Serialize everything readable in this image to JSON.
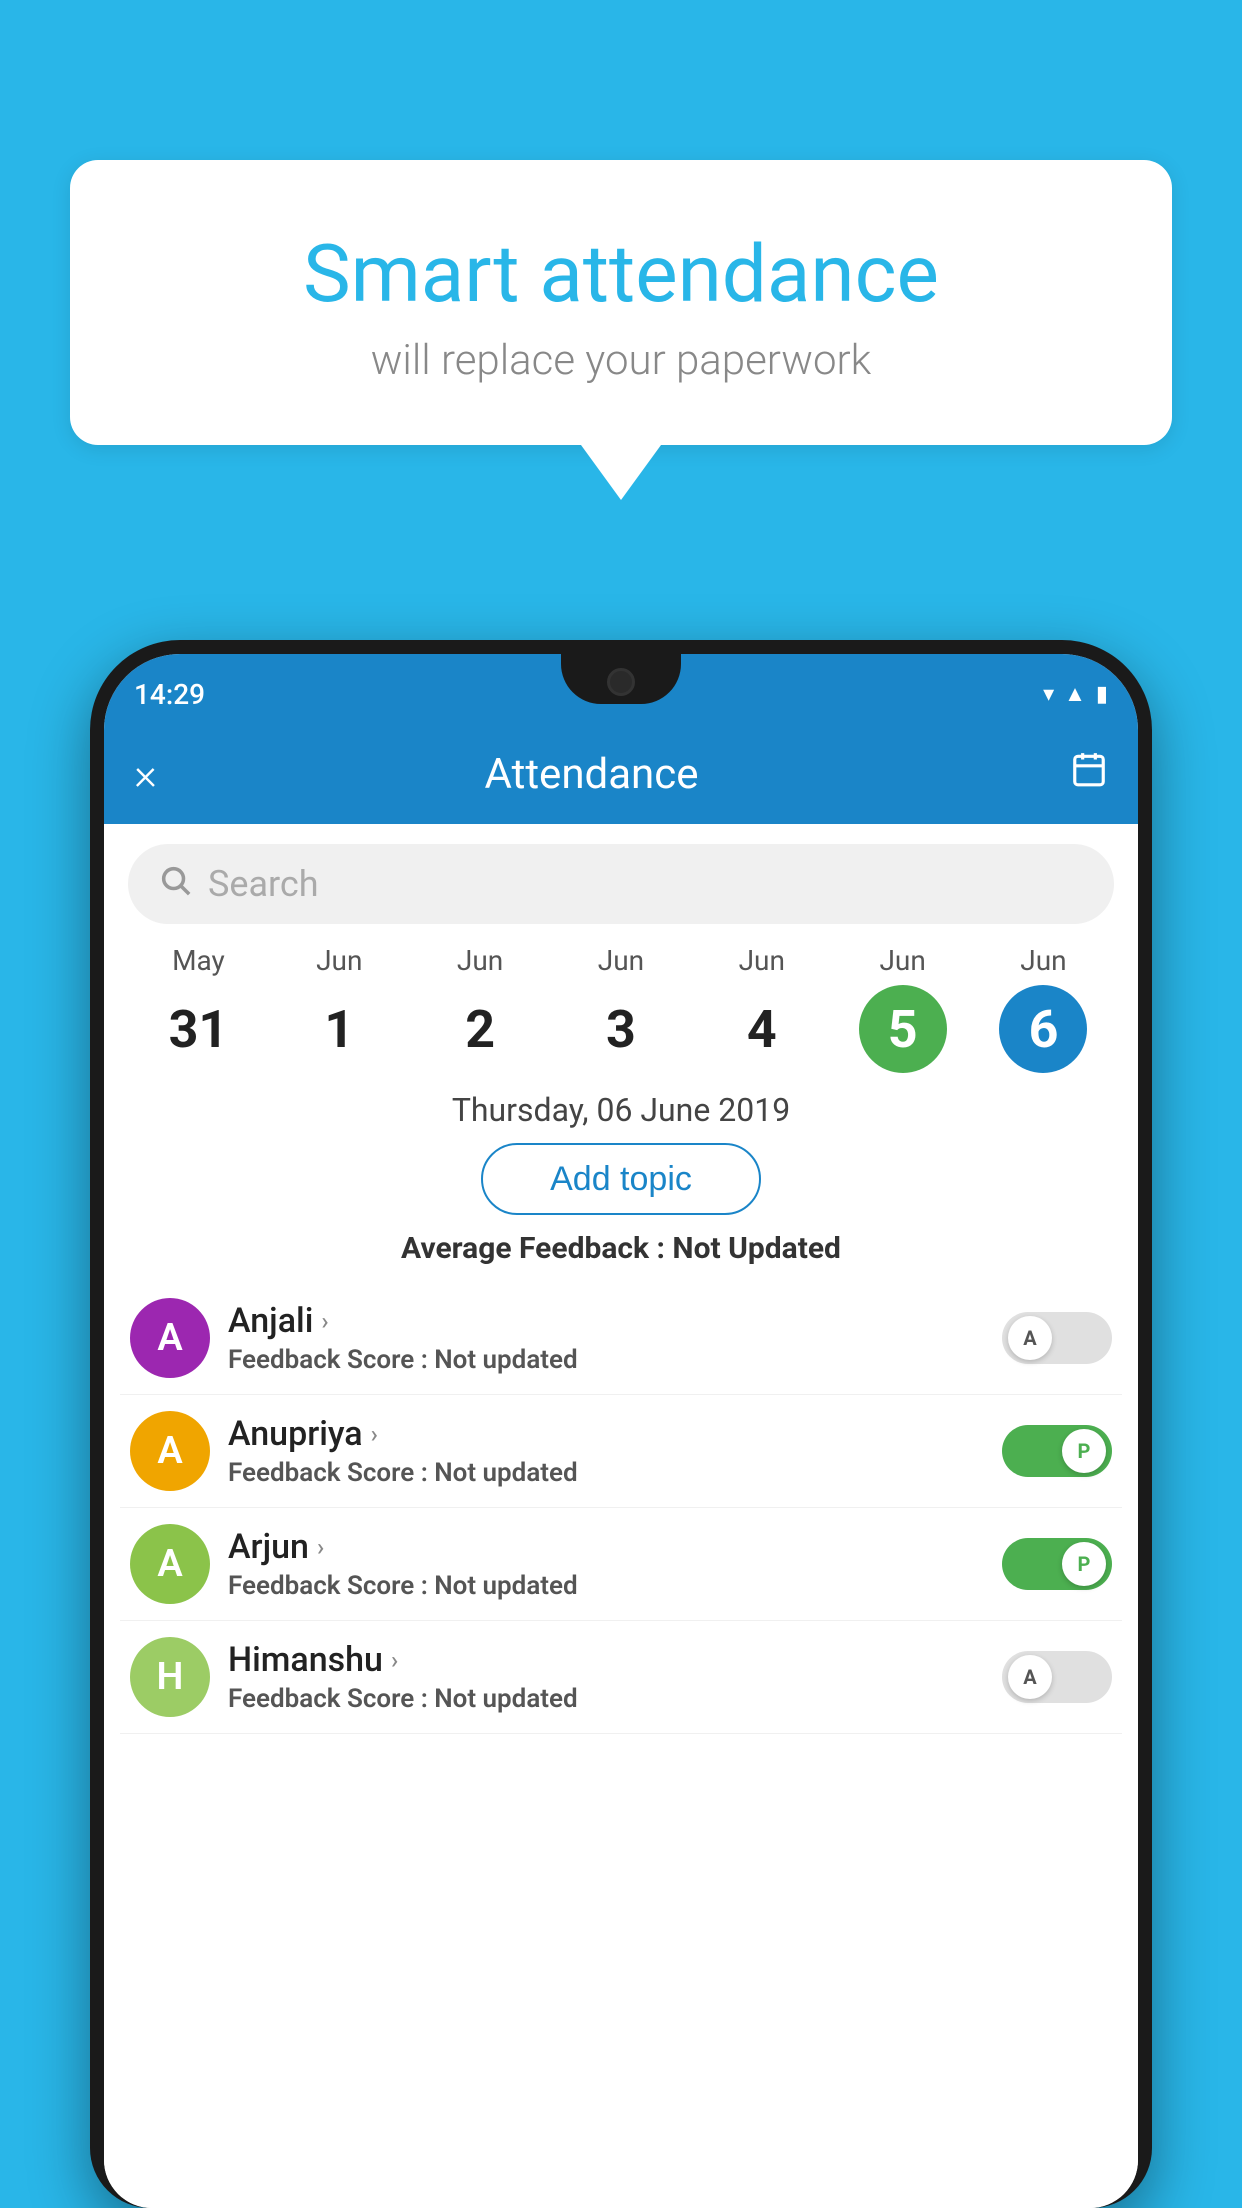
{
  "background_color": "#29b6e8",
  "bubble": {
    "title": "Smart attendance",
    "subtitle": "will replace your paperwork"
  },
  "status_bar": {
    "time": "14:29",
    "icons": [
      "wifi",
      "signal",
      "battery"
    ]
  },
  "app_bar": {
    "close_label": "×",
    "title": "Attendance",
    "calendar_icon": "📅"
  },
  "search": {
    "placeholder": "Search"
  },
  "calendar": {
    "days": [
      {
        "month": "May",
        "date": "31",
        "state": "normal"
      },
      {
        "month": "Jun",
        "date": "1",
        "state": "normal"
      },
      {
        "month": "Jun",
        "date": "2",
        "state": "normal"
      },
      {
        "month": "Jun",
        "date": "3",
        "state": "normal"
      },
      {
        "month": "Jun",
        "date": "4",
        "state": "normal"
      },
      {
        "month": "Jun",
        "date": "5",
        "state": "today"
      },
      {
        "month": "Jun",
        "date": "6",
        "state": "selected"
      }
    ]
  },
  "selected_date": "Thursday, 06 June 2019",
  "add_topic_label": "Add topic",
  "avg_feedback": {
    "label": "Average Feedback :",
    "value": "Not Updated"
  },
  "students": [
    {
      "name": "Anjali",
      "avatar_letter": "A",
      "avatar_color": "#9c27b0",
      "feedback_label": "Feedback Score :",
      "feedback_value": "Not updated",
      "toggle": "off",
      "toggle_label": "A"
    },
    {
      "name": "Anupriya",
      "avatar_letter": "A",
      "avatar_color": "#f0a500",
      "feedback_label": "Feedback Score :",
      "feedback_value": "Not updated",
      "toggle": "on",
      "toggle_label": "P"
    },
    {
      "name": "Arjun",
      "avatar_letter": "A",
      "avatar_color": "#8bc34a",
      "feedback_label": "Feedback Score :",
      "feedback_value": "Not updated",
      "toggle": "on",
      "toggle_label": "P"
    },
    {
      "name": "Himanshu",
      "avatar_letter": "H",
      "avatar_color": "#9ccc65",
      "feedback_label": "Feedback Score :",
      "feedback_value": "Not updated",
      "toggle": "off",
      "toggle_label": "A"
    }
  ]
}
